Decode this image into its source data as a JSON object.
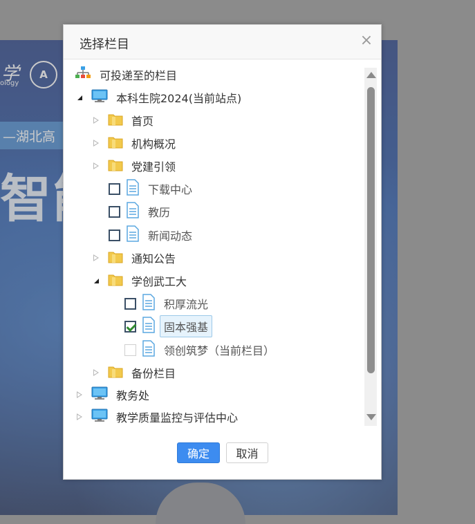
{
  "background": {
    "logo_text": "学",
    "logo_sub": "ology",
    "emblem_text": "A",
    "band_text": "—湖北高",
    "headline_text": "智能"
  },
  "dialog": {
    "title": "选择栏目",
    "close_symbol": "×",
    "ok_label": "确定",
    "cancel_label": "取消"
  },
  "tree": {
    "root_label": "可投递至的栏目",
    "site1": "本科生院2024(当前站点)",
    "n_home": "首页",
    "n_org": "机构概况",
    "n_party": "党建引领",
    "n_download": "下载中心",
    "n_jiaoli": "教历",
    "n_news": "新闻动态",
    "n_notice": "通知公告",
    "n_xuechuang": "学创武工大",
    "n_jihou": "积厚流光",
    "n_guben": "固本强基",
    "n_lingchuang": "领创筑梦（当前栏目）",
    "n_backup": "备份栏目",
    "site2": "教务处",
    "site3": "教学质量监控与评估中心"
  },
  "colors": {
    "accent": "#3d8cf0",
    "folder": "#f2c94c",
    "monitor": "#3aa0e6",
    "doc": "#5aa7e0",
    "check": "#2f8a2f"
  }
}
